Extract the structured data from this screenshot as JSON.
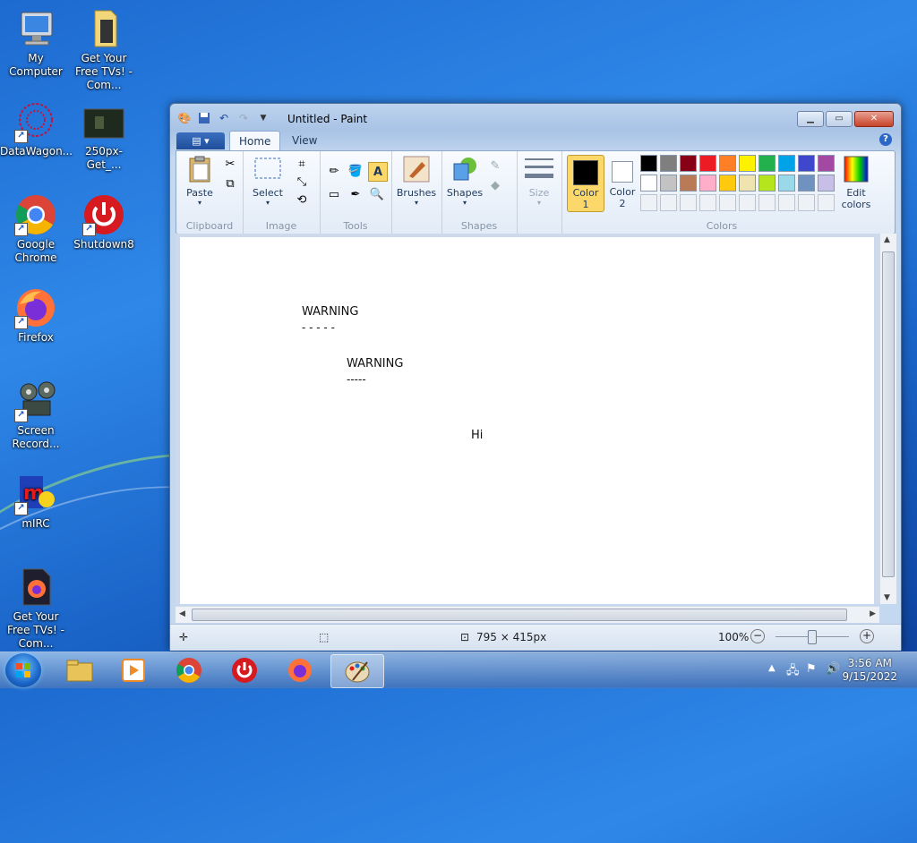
{
  "desktop": {
    "icons": [
      {
        "label": "My Computer"
      },
      {
        "label": "Get Your Free TVs! - Com..."
      },
      {
        "label": "DataWagon..."
      },
      {
        "label": "250px-Get_..."
      },
      {
        "label": "Google Chrome"
      },
      {
        "label": "Shutdown8"
      },
      {
        "label": "Firefox"
      },
      {
        "label": "Screen Record..."
      },
      {
        "label": "mIRC"
      },
      {
        "label": "Get Your Free TVs! - Com..."
      }
    ]
  },
  "window": {
    "title": "Untitled - Paint",
    "file_menu_icon": "paint-menu-icon",
    "tabs": [
      {
        "label": "Home"
      },
      {
        "label": "View"
      }
    ],
    "groups": {
      "clipboard": {
        "label": "Clipboard",
        "paste": "Paste"
      },
      "image": {
        "label": "Image",
        "select": "Select"
      },
      "tools": {
        "label": "Tools"
      },
      "brushes": {
        "label": "Brushes"
      },
      "shapes": {
        "label": "Shapes",
        "shapes_btn": "Shapes"
      },
      "size": {
        "label": "Size"
      },
      "colors": {
        "label": "Colors",
        "color1_l1": "Color",
        "color1_l2": "1",
        "color2_l1": "Color",
        "color2_l2": "2",
        "edit_l1": "Edit",
        "edit_l2": "colors"
      }
    },
    "palette_row1": [
      "#000000",
      "#7f7f7f",
      "#880015",
      "#ed1c24",
      "#ff7f27",
      "#fff200",
      "#22b14c",
      "#00a2e8",
      "#3f48cc",
      "#a349a4"
    ],
    "palette_row2": [
      "#ffffff",
      "#c3c3c3",
      "#b97a57",
      "#ffaec9",
      "#ffc90e",
      "#efe4b0",
      "#b5e61d",
      "#99d9ea",
      "#7092be",
      "#c8bfe7"
    ],
    "color1": "#000000",
    "color2": "#ffffff",
    "canvas_texts": {
      "warning1": "WARNING",
      "dashes1": "- - - - -",
      "warning2": "WARNING",
      "dashes2": "-----",
      "hi": "Hi"
    },
    "status": {
      "dimensions": "795 × 415px",
      "zoom": "100%"
    }
  },
  "taskbar": {
    "time": "3:56 AM",
    "date": "9/15/2022"
  }
}
